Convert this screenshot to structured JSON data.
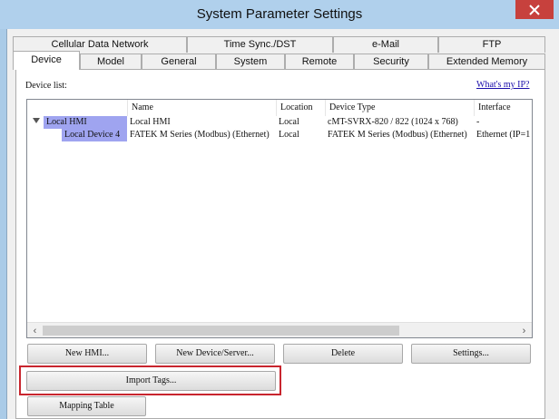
{
  "window": {
    "title": "System Parameter Settings",
    "close_icon": "close-icon"
  },
  "tabs_row1": [
    {
      "label": "Cellular Data Network"
    },
    {
      "label": "Time Sync./DST"
    },
    {
      "label": "e-Mail"
    },
    {
      "label": "FTP"
    }
  ],
  "tabs_row2": [
    {
      "label": "Device",
      "active": true
    },
    {
      "label": "Model"
    },
    {
      "label": "General"
    },
    {
      "label": "System"
    },
    {
      "label": "Remote"
    },
    {
      "label": "Security"
    },
    {
      "label": "Extended Memory"
    }
  ],
  "device_list": {
    "label": "Device list:",
    "myip_link": "What's my IP?",
    "columns": [
      "Name",
      "Location",
      "Device Type",
      "Interface"
    ],
    "rows": [
      {
        "tree_label": "Local HMI",
        "name": "Local HMI",
        "location": "Local",
        "device_type": "cMT-SVRX-820 / 822 (1024 x 768)",
        "interface": "-"
      },
      {
        "tree_label": "Local Device 4",
        "name": "FATEK M Series (Modbus) (Ethernet)",
        "location": "Local",
        "device_type": "FATEK M Series (Modbus) (Ethernet)",
        "interface": "Ethernet (IP=1"
      }
    ]
  },
  "buttons": {
    "new_hmi": "New HMI...",
    "new_device": "New Device/Server...",
    "delete": "Delete",
    "settings": "Settings...",
    "import_tags": "Import Tags...",
    "mapping_table": "Mapping Table"
  },
  "colors": {
    "title_bg": "#b0d0ec",
    "close_bg": "#c7413d",
    "selected_node": "#9fa4f0",
    "highlight_border": "#c8252e",
    "link": "#1a0dab"
  }
}
